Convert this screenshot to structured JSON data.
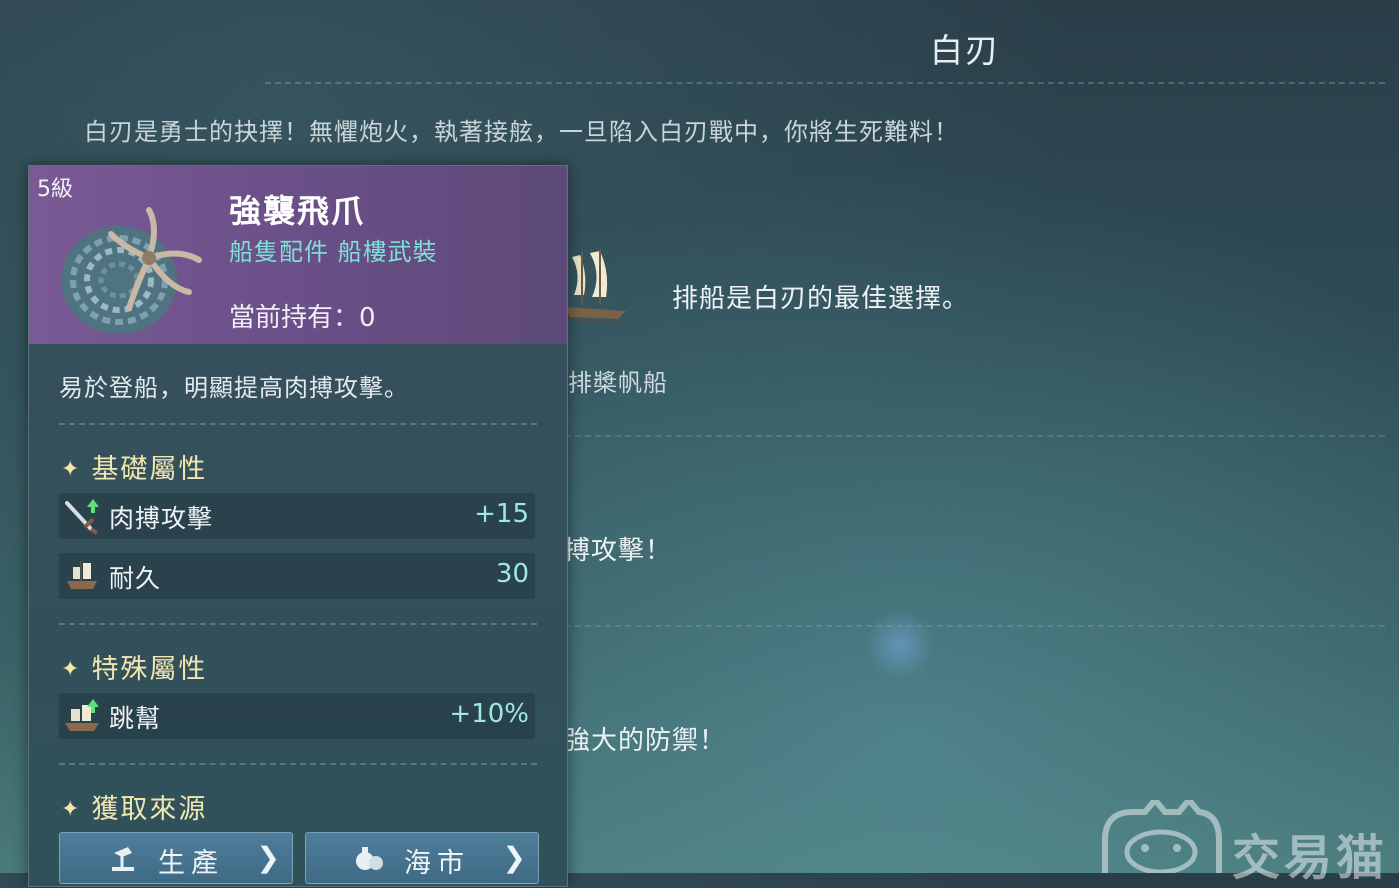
{
  "page": {
    "title": "白刃",
    "description": "白刃是勇士的抉擇！無懼炮火，執著接舷，一旦陷入白刃戰中，你將生死難料！",
    "ship_desc": "排船是白刃的最佳選擇。",
    "ship_name": "排槳帆船",
    "line2_fragment": "搏攻擊！",
    "line3_fragment": "強大的防禦！"
  },
  "item": {
    "level": "5級",
    "name": "強襲飛爪",
    "type": "船隻配件 船樓武裝",
    "owned_label": "當前持有：",
    "owned_value": "0",
    "description": "易於登船，明顯提高肉搏攻擊。",
    "sections": {
      "basic": "基礎屬性",
      "special": "特殊屬性",
      "source": "獲取來源"
    },
    "basic_stats": [
      {
        "icon": "sword-icon",
        "label": "肉搏攻擊",
        "value": "+15"
      },
      {
        "icon": "ship-hull-icon",
        "label": "耐久",
        "value": "30"
      }
    ],
    "special_stats": [
      {
        "icon": "boarding-ship-icon",
        "label": "跳幫",
        "value": "+10%"
      }
    ],
    "source_buttons": [
      {
        "icon": "production-icon",
        "label": "生產"
      },
      {
        "icon": "sea-market-icon",
        "label": "海市"
      }
    ]
  },
  "watermark": {
    "text": "交易猫"
  },
  "colors": {
    "header_purple": "#7a5a96",
    "type_teal": "#7fe0d8",
    "section_gold": "#f1e6b0",
    "stat_value": "#9ee8e0",
    "button_blue": "#4f7e9a"
  }
}
